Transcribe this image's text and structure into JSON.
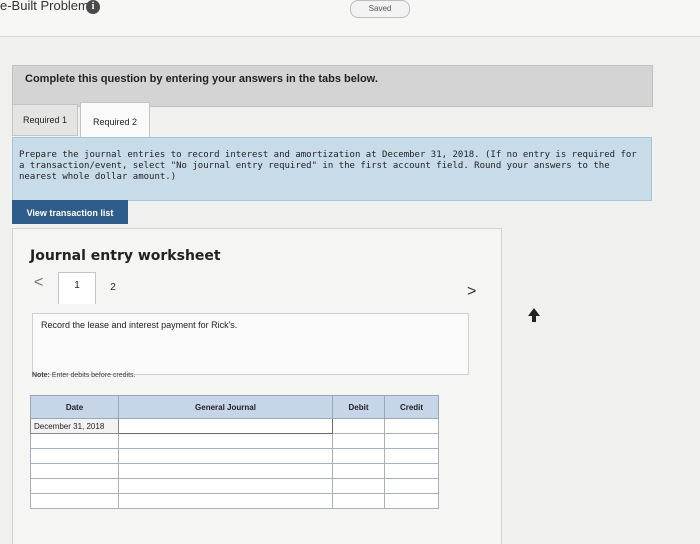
{
  "header": {
    "app_title": "e-Built Problems",
    "saved_label": "Saved"
  },
  "instructions": "Complete this question by entering your answers in the tabs below.",
  "tabs": [
    {
      "label": "Required 1"
    },
    {
      "label": "Required 2"
    }
  ],
  "task": {
    "text": "Prepare the journal entries to record interest and amortization at December 31, 2018. (If no entry is required for a transaction/event, select \"No journal entry required\" in the first account field. Round your answers to the nearest whole dollar amount.)"
  },
  "view_button_label": "View transaction list",
  "worksheet": {
    "title": "Journal entry worksheet",
    "prev_symbol": "<",
    "next_symbol": ">",
    "pages": [
      "1",
      "2"
    ],
    "record_text": "Record the lease and interest payment for Rick's.",
    "note_label": "Note:",
    "note_text": "Enter debits before credits."
  },
  "journal": {
    "headers": [
      "Date",
      "General Journal",
      "Debit",
      "Credit"
    ],
    "first_date": "December 31, 2018"
  },
  "colors": {
    "button": "#2e5d8c",
    "task_bg": "#c8dbe8",
    "header_bg": "#c6d6e8"
  }
}
